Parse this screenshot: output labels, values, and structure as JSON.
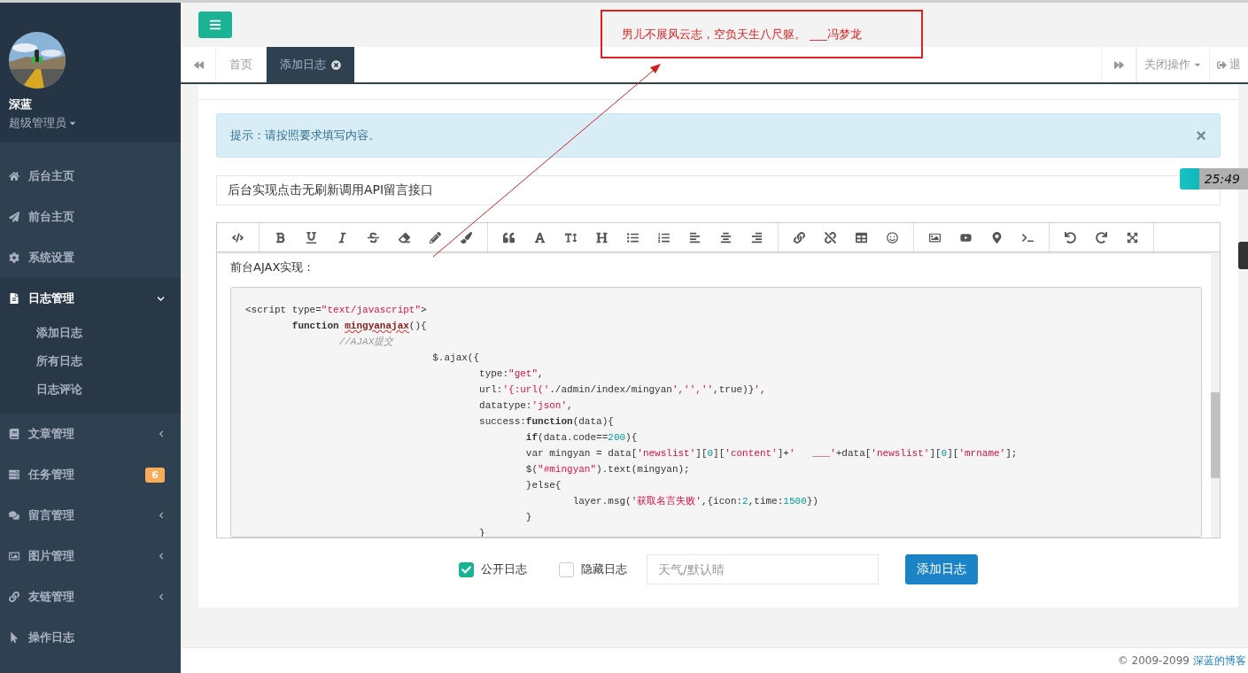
{
  "profile": {
    "name": "深蓝",
    "role": "超级管理员"
  },
  "sidebar": {
    "items": [
      {
        "label": "后台主页",
        "selected": false
      },
      {
        "label": "前台主页",
        "selected": false
      },
      {
        "label": "系统设置",
        "selected": false
      },
      {
        "label": "日志管理",
        "selected": true,
        "expanded": true,
        "children": [
          {
            "label": "添加日志"
          },
          {
            "label": "所有日志"
          },
          {
            "label": "日志评论"
          }
        ]
      },
      {
        "label": "文章管理",
        "selected": false,
        "expanded": false
      },
      {
        "label": "任务管理",
        "selected": false,
        "badge": "6"
      },
      {
        "label": "留言管理",
        "selected": false,
        "expanded": false
      },
      {
        "label": "图片管理",
        "selected": false,
        "expanded": false
      },
      {
        "label": "友链管理",
        "selected": false,
        "expanded": false
      },
      {
        "label": "操作日志",
        "selected": false
      }
    ]
  },
  "tabs": [
    {
      "label": "首页",
      "selected": false
    },
    {
      "label": "添加日志",
      "selected": true
    }
  ],
  "tab_actions": {
    "close_menu": "关闭操作",
    "logout": "退"
  },
  "annotation": {
    "text": "男儿不展风云志，空负天生八尺躯。 ___冯梦龙"
  },
  "timer": "25:49",
  "alert": {
    "text": "提示：请按照要求填写内容。",
    "close": "×"
  },
  "title_field": {
    "value": "后台实现点击无刷新调用API留言接口"
  },
  "editor": {
    "intro": "前台AJAX实现：",
    "code": [
      [
        {
          "text": "<script type=",
          "kind": "plain"
        },
        {
          "text": "\"text/javascript\"",
          "kind": "string"
        },
        {
          "text": ">",
          "kind": "plain"
        }
      ],
      [
        {
          "text": "\tfunction ",
          "kind": "keyword"
        },
        {
          "text": "mingyanajax",
          "kind": "flagged"
        },
        {
          "text": "(){",
          "kind": "plain"
        }
      ],
      [
        {
          "text": "\t\t//AJAX提交",
          "kind": "comment"
        }
      ],
      [
        {
          "text": "\t\t\t\t$.ajax({",
          "kind": "plain"
        }
      ],
      [
        {
          "text": "\t\t\t\t\ttype:",
          "kind": "plain"
        },
        {
          "text": "\"get\"",
          "kind": "string"
        },
        {
          "text": ",",
          "kind": "plain"
        }
      ],
      [
        {
          "text": "\t\t\t\t\turl:",
          "kind": "plain"
        },
        {
          "text": "'{:url('",
          "kind": "string"
        },
        {
          "text": "./admin/index/mingyan",
          "kind": "plain"
        },
        {
          "text": "','',''",
          "kind": "string"
        },
        {
          "text": ",true)}",
          "kind": "plain"
        },
        {
          "text": "'",
          "kind": "string"
        },
        {
          "text": ",",
          "kind": "plain"
        }
      ],
      [
        {
          "text": "\t\t\t\t\tdatatype:",
          "kind": "plain"
        },
        {
          "text": "'json'",
          "kind": "string"
        },
        {
          "text": ",",
          "kind": "plain"
        }
      ],
      [
        {
          "text": "\t\t\t\t\tsuccess:",
          "kind": "plain"
        },
        {
          "text": "function",
          "kind": "keyword"
        },
        {
          "text": "(data){",
          "kind": "plain"
        }
      ],
      [
        {
          "text": "\t\t\t\t\t\tif",
          "kind": "keyword"
        },
        {
          "text": "(data.code==",
          "kind": "plain"
        },
        {
          "text": "200",
          "kind": "number"
        },
        {
          "text": "){",
          "kind": "plain"
        }
      ],
      [
        {
          "text": "\t\t\t\t\t\tvar mingyan = data[",
          "kind": "plain"
        },
        {
          "text": "'newslist'",
          "kind": "string"
        },
        {
          "text": "][",
          "kind": "plain"
        },
        {
          "text": "0",
          "kind": "number"
        },
        {
          "text": "][",
          "kind": "plain"
        },
        {
          "text": "'content'",
          "kind": "string"
        },
        {
          "text": "]+",
          "kind": "plain"
        },
        {
          "text": "'   ___'",
          "kind": "string"
        },
        {
          "text": "+data[",
          "kind": "plain"
        },
        {
          "text": "'newslist'",
          "kind": "string"
        },
        {
          "text": "][",
          "kind": "plain"
        },
        {
          "text": "0",
          "kind": "number"
        },
        {
          "text": "][",
          "kind": "plain"
        },
        {
          "text": "'mrname'",
          "kind": "string"
        },
        {
          "text": "];",
          "kind": "plain"
        }
      ],
      [
        {
          "text": "\t\t\t\t\t\t$(",
          "kind": "plain"
        },
        {
          "text": "\"#mingyan\"",
          "kind": "string"
        },
        {
          "text": ").text(mingyan);",
          "kind": "plain"
        }
      ],
      [
        {
          "text": "\t\t\t\t\t\t}else{",
          "kind": "plain"
        }
      ],
      [
        {
          "text": "\t\t\t\t\t\t\tlayer.msg(",
          "kind": "plain"
        },
        {
          "text": "'获取名言失败'",
          "kind": "string"
        },
        {
          "text": ",{icon:",
          "kind": "plain"
        },
        {
          "text": "2",
          "kind": "number"
        },
        {
          "text": ",time:",
          "kind": "plain"
        },
        {
          "text": "1500",
          "kind": "number"
        },
        {
          "text": "})",
          "kind": "plain"
        }
      ],
      [
        {
          "text": "\t\t\t\t\t\t}",
          "kind": "plain"
        }
      ],
      [
        {
          "text": "\t\t\t\t\t}",
          "kind": "plain"
        }
      ]
    ]
  },
  "options": [
    {
      "label": "公开日志",
      "checked": true
    },
    {
      "label": "隐藏日志",
      "checked": false
    }
  ],
  "weather_field": {
    "placeholder": "天气/默认晴"
  },
  "submit": "添加日志",
  "footer": {
    "copyright": "© 2009-2099",
    "link": "深蓝的博客"
  }
}
